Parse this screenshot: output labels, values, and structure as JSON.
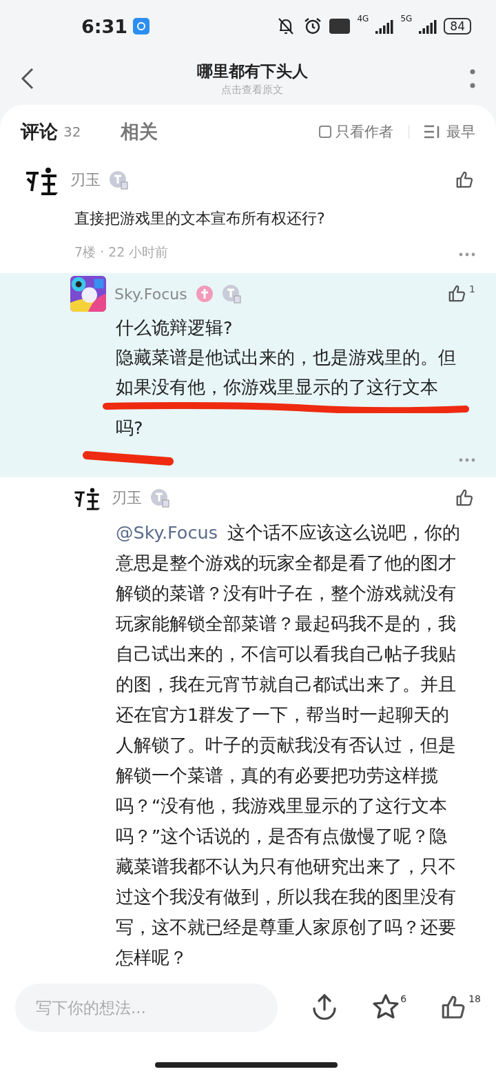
{
  "status_bar": {
    "time": "6:31",
    "network_1": "4G",
    "network_2": "5G",
    "battery": "84"
  },
  "header": {
    "title": "哪里都有下头人",
    "subtitle": "点击查看原文"
  },
  "tabs": [
    {
      "label": "评论",
      "count": "32",
      "selected": true
    },
    {
      "label": "相关",
      "selected": false
    }
  ],
  "filters": {
    "author_only": {
      "label": "只看作者",
      "checked": false
    },
    "sort": {
      "label": "最早"
    }
  },
  "comment": {
    "author": "刃玉",
    "text": "直接把游戏里的文本宣布所有权还行?",
    "meta": "7楼 · 22 小时前",
    "replies": [
      {
        "author": "Sky.Focus",
        "likes": "1",
        "highlighted": true,
        "content": [
          {
            "kind": "text",
            "text": "什么诡辩逻辑?"
          },
          {
            "kind": "text",
            "text": "隐藏菜谱是他试出来的，也是游戏里的。但如果没有他，你游戏里显示的了这行文本"
          },
          {
            "kind": "underline"
          },
          {
            "kind": "text",
            "text": "吗?"
          }
        ]
      },
      {
        "author": "刃玉",
        "highlighted": false,
        "mention": "@Sky.Focus",
        "content": [
          {
            "kind": "text",
            "text": "这个话不应该这么说吧，你的意思是整个游戏的玩家全都是看了他的图才解锁的菜谱？没有叶子在，整个游戏就没有玩家能解锁全部菜谱？最起码我不是的，我自己试出来的，不信可以看我自己帖子我贴的图，我在元宵节就自己都试出来了。并且还在官方1群发了一下，帮当时一起聊天的人解锁了。叶子的贡献我没有否认过，但是解锁一个菜谱，真的有必要把功劳这样揽吗？“没有他，我游戏里显示的了这行文本吗？”这个话说的，是否有点傲慢了呢？隐藏菜谱我都不认为只有他研究出来了，只不过这个我没有做到，所以我在我的图里没有写，这不就已经是尊重人家原创了吗？还要怎样呢？"
          }
        ]
      }
    ]
  },
  "bottom_bar": {
    "placeholder": "写下你的想法...",
    "favorites": "6",
    "likes": "18"
  }
}
